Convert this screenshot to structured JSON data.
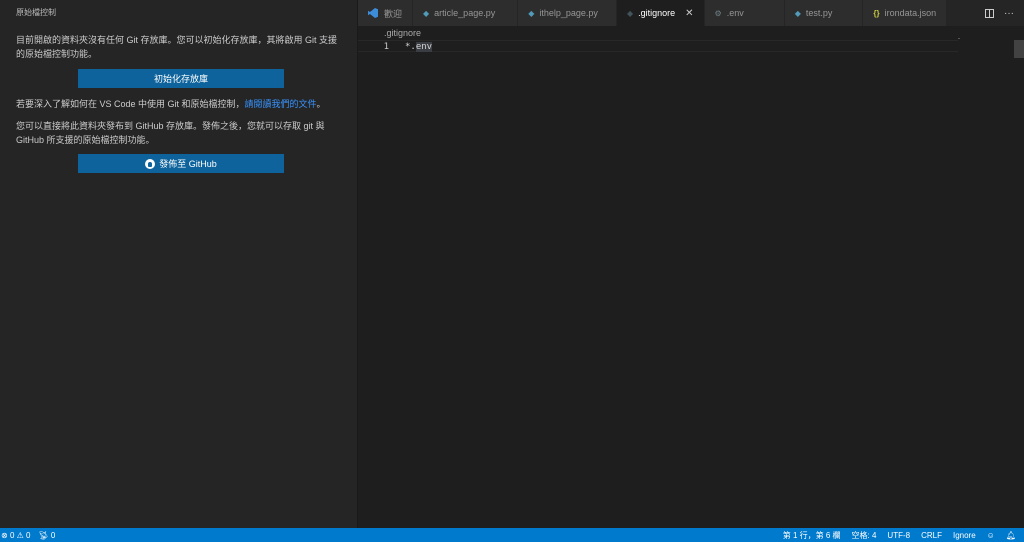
{
  "sidebar": {
    "title": "原始檔控制",
    "intro_text": "目前開啟的資料夾沒有任何 Git 存放庫。您可以初始化存放庫，其將啟用 Git 支援的原始檔控制功能。",
    "init_button_label": "初始化存放庫",
    "learn_prefix": "若要深入了解如何在 VS Code 中使用 Git 和原始檔控制，",
    "learn_link": "請閱讀我們的文件",
    "learn_suffix": "。",
    "publish_text": "您可以直接將此資料夾發布到 GitHub 存放庫。發佈之後，您就可以存取 git 與 GitHub 所支援的原始檔控制功能。",
    "publish_button_label": "發佈至 GitHub"
  },
  "tabs": [
    {
      "label": "歡迎",
      "icon": "vscode-logo-icon",
      "active": false
    },
    {
      "label": "article_page.py",
      "icon": "python-file-icon",
      "active": false
    },
    {
      "label": "ithelp_page.py",
      "icon": "python-file-icon",
      "active": false
    },
    {
      "label": ".gitignore",
      "icon": "git-file-icon",
      "active": true
    },
    {
      "label": ".env",
      "icon": "gear-icon",
      "active": false
    },
    {
      "label": "test.py",
      "icon": "python-file-icon",
      "active": false
    },
    {
      "label": "irondata.json",
      "icon": "json-file-icon",
      "active": false
    }
  ],
  "tab_actions": {
    "split_icon": "split-editor-icon",
    "more_glyph": "···"
  },
  "breadcrumb": {
    "file": ".gitignore"
  },
  "editor": {
    "lines": [
      {
        "number": "1",
        "prefix": "*.",
        "highlighted": "env"
      }
    ]
  },
  "statusbar": {
    "errors": "0",
    "warnings": "0",
    "ports": "0",
    "cursor_position": "第 1 行，第 6 欄",
    "indentation": "空格: 4",
    "encoding": "UTF-8",
    "eol": "CRLF",
    "language": "Ignore"
  },
  "colors": {
    "accent": "#007acc",
    "button": "#0e639c",
    "link": "#3794ff",
    "sidebar_bg": "#252526",
    "editor_bg": "#1e1e1e"
  }
}
